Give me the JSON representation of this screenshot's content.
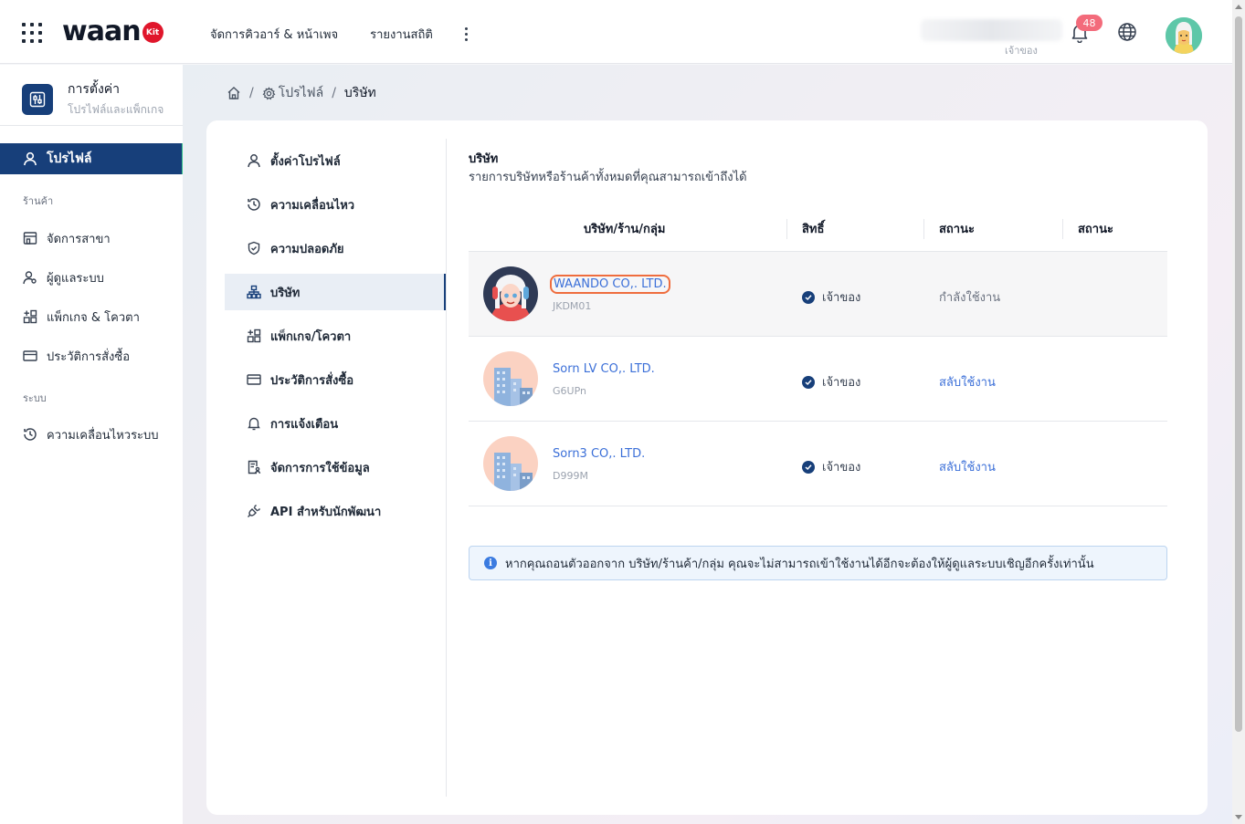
{
  "topbar": {
    "logo_text": "waan",
    "logo_badge": "Kit",
    "nav": [
      "จัดการคิวอาร์ & หน้าเพจ",
      "รายงานสถิติ"
    ],
    "user_role": "เจ้าของ",
    "notification_count": "48"
  },
  "sidebar": {
    "title": "การตั้งค่า",
    "subtitle": "โปรไฟล์และแพ็กเกจ",
    "active_item": "โปรไฟล์",
    "group_shop": "ร้านค้า",
    "shop_items": [
      "จัดการสาขา",
      "ผู้ดูแลระบบ",
      "แพ็กเกจ & โควตา",
      "ประวัติการสั่งซื้อ"
    ],
    "group_system": "ระบบ",
    "system_items": [
      "ความเคลื่อนไหวระบบ"
    ]
  },
  "breadcrumb": {
    "profile": "โปรไฟล์",
    "current": "บริษัท"
  },
  "subnav": [
    "ตั้งค่าโปรไฟล์",
    "ความเคลื่อนไหว",
    "ความปลอดภัย",
    "บริษัท",
    "แพ็กเกจ/โควตา",
    "ประวัติการสั่งซื้อ",
    "การแจ้งเตือน",
    "จัดการการใช้ข้อมูล",
    "API สำหรับนักพัฒนา"
  ],
  "section": {
    "title": "บริษัท",
    "description": "รายการบริษัทหรือร้านค้าทั้งหมดที่คุณสามารถเข้าถึงได้"
  },
  "table": {
    "headers": [
      "บริษัท/ร้าน/กลุ่ม",
      "สิทธิ์",
      "สถานะ",
      "สถานะ"
    ],
    "rows": [
      {
        "name": "WAANDO CO,. LTD.",
        "code": "JKDM01",
        "role": "เจ้าของ",
        "status": "กำลังใช้งาน"
      },
      {
        "name": "Sorn LV CO,. LTD.",
        "code": "G6UPn",
        "role": "เจ้าของ",
        "status": "สลับใช้งาน"
      },
      {
        "name": "Sorn3 CO,. LTD.",
        "code": "D999M",
        "role": "เจ้าของ",
        "status": "สลับใช้งาน"
      }
    ]
  },
  "info_message": "หากคุณถอนตัวออกจาก บริษัท/ร้านค้า/กลุ่ม คุณจะไม่สามารถเข้าใช้งานได้อีกจะต้องให้ผู้ดูแลระบบเชิญอีกครั้งเท่านั้น",
  "colors": {
    "brand_navy": "#173f7a",
    "link_blue": "#3b6fd8",
    "badge_red": "#e0162b",
    "highlight_orange": "#ef6d3e"
  }
}
